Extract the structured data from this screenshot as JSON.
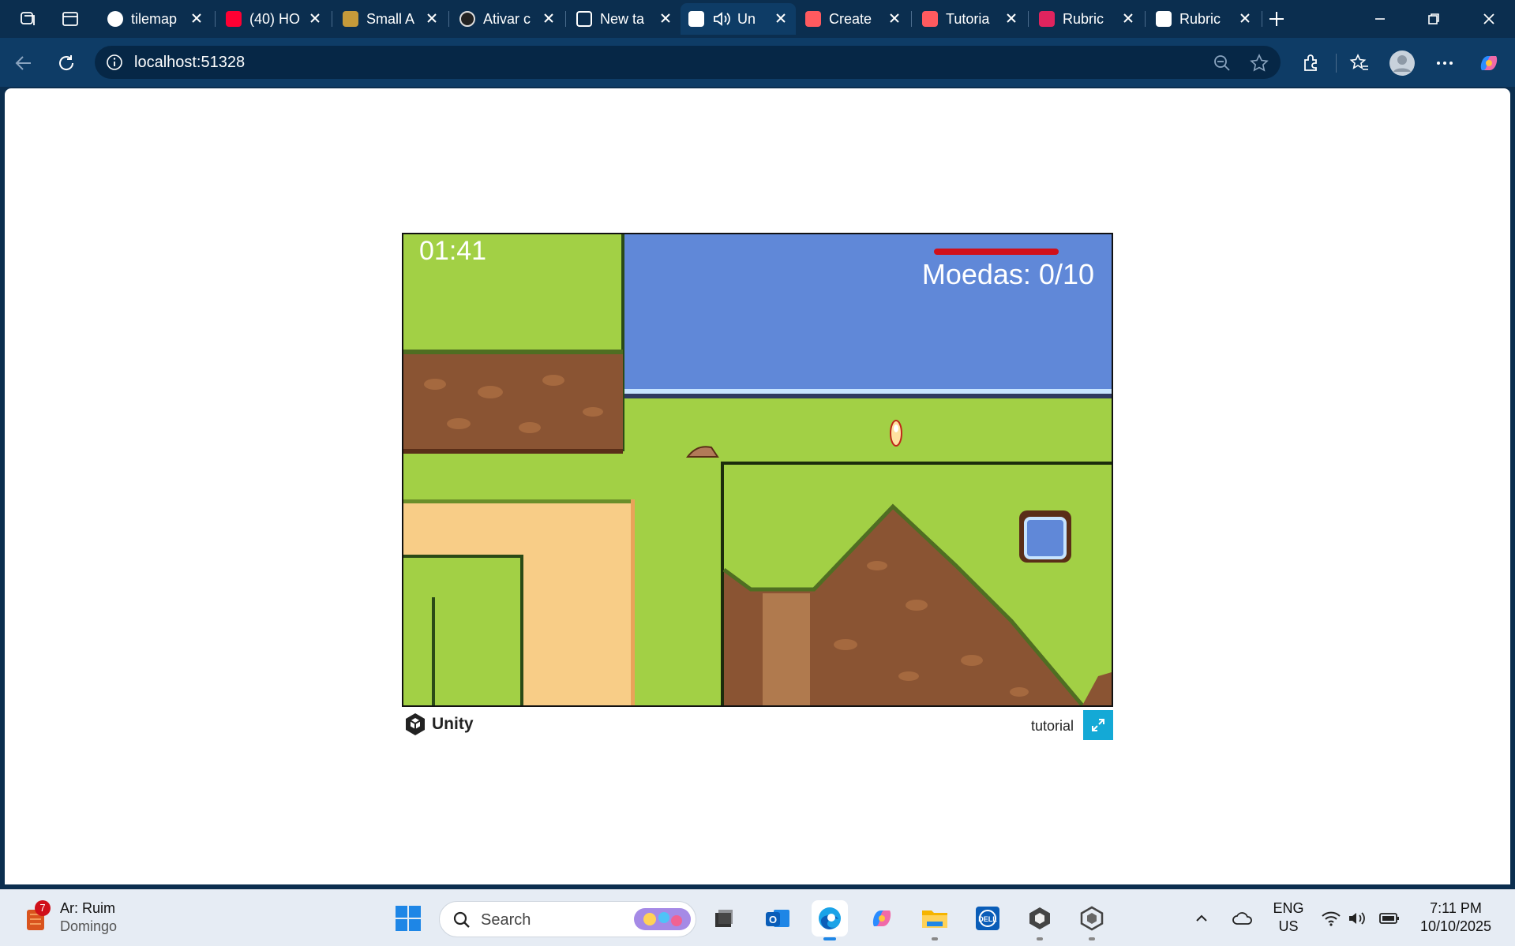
{
  "browser": {
    "tabs": [
      {
        "label": "tilemap",
        "color": "#ffffff"
      },
      {
        "label": "(40) HO",
        "color": "#ff0033"
      },
      {
        "label": "Small A",
        "color": "#c59a3a"
      },
      {
        "label": "Ativar c",
        "color": "#dddddd"
      },
      {
        "label": "New ta",
        "color": "#ffffff"
      },
      {
        "label": "Un",
        "color": "#ffffff"
      },
      {
        "label": "Create",
        "color": "#ff5a5f"
      },
      {
        "label": "Tutoria",
        "color": "#ff5a5f"
      },
      {
        "label": "Rubric",
        "color": "#e0245e"
      },
      {
        "label": "Rubric",
        "color": "#ffffff"
      }
    ],
    "address_url": "localhost:51328"
  },
  "game": {
    "timer": "01:41",
    "coins_label": "Moedas: 0/10",
    "health_fraction": 1.0,
    "colors": {
      "grass": "#a2d045",
      "water": "#6088d8",
      "dirt": "#8a5433",
      "sand": "#f8cd87"
    }
  },
  "unity_footer": {
    "logo_text": "Unity",
    "build_title": "tutorial"
  },
  "taskbar": {
    "weather_badge": "7",
    "weather_line1": "Ar: Ruim",
    "weather_line2": "Domingo",
    "search_placeholder": "Search",
    "lang_line1": "ENG",
    "lang_line2": "US",
    "time": "7:11 PM",
    "date": "10/10/2025"
  }
}
